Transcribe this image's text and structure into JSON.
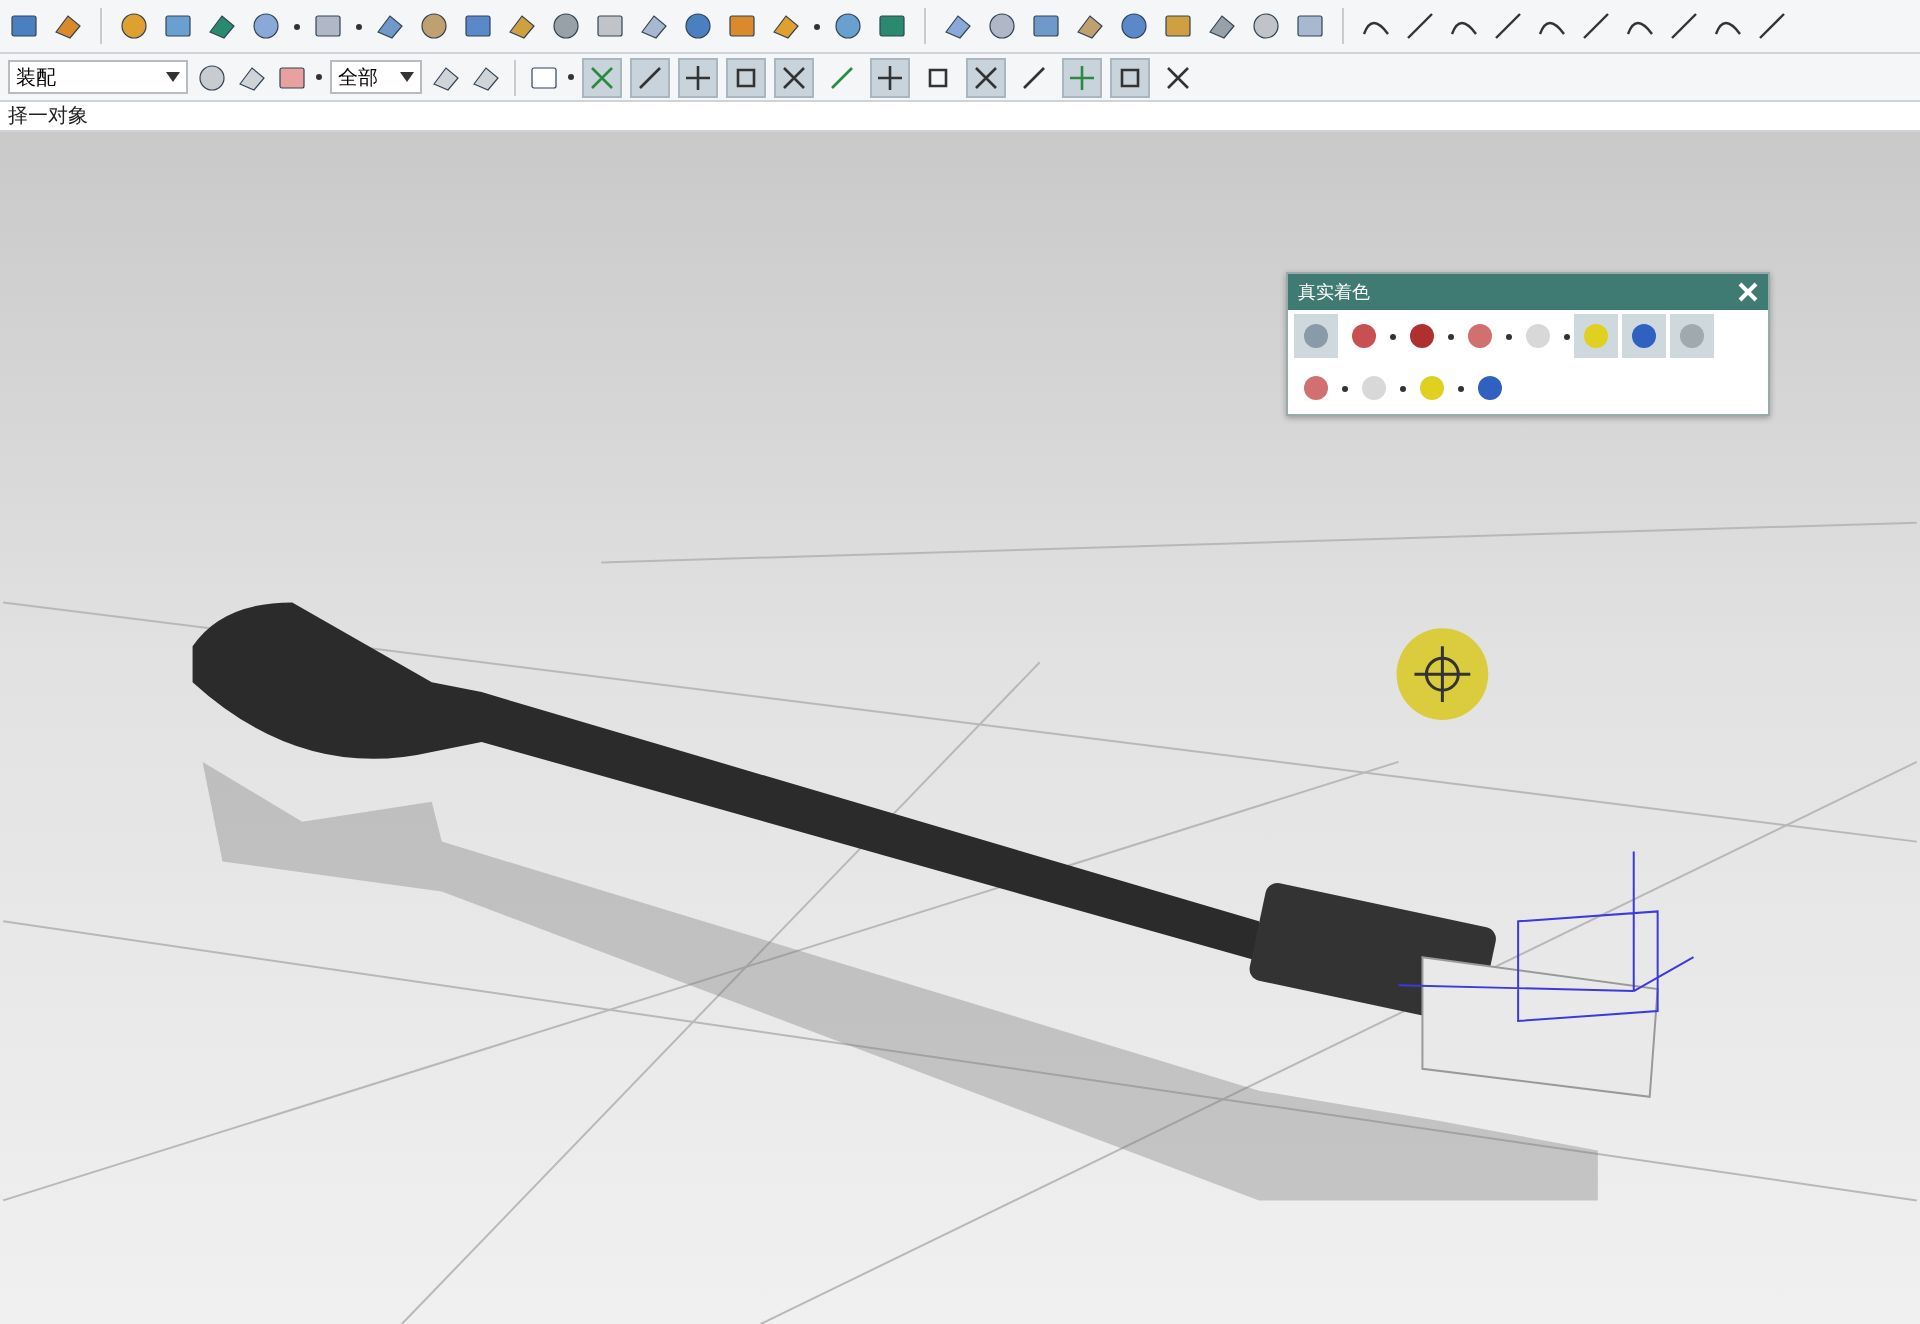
{
  "selection_bar": {
    "filter_dropdown": {
      "value": "装配"
    },
    "scope_dropdown": {
      "value": "全部"
    },
    "snap_buttons": [
      {
        "selected": true
      },
      {
        "selected": true
      },
      {
        "selected": true
      },
      {
        "selected": true
      },
      {
        "selected": true
      },
      {
        "selected": false
      },
      {
        "selected": true
      },
      {
        "selected": false
      },
      {
        "selected": true
      },
      {
        "selected": false
      },
      {
        "selected": true
      },
      {
        "selected": true
      },
      {
        "selected": false
      }
    ]
  },
  "prompt": "择一对象",
  "shading_panel": {
    "title": "真实着色",
    "tool_rows": [
      [
        {
          "selected": true
        },
        {
          "selected": false
        },
        {
          "selected": false
        },
        {
          "selected": false
        },
        {
          "selected": false
        },
        {
          "selected": true
        },
        {
          "selected": true
        },
        {
          "selected": true
        }
      ],
      [
        {
          "selected": false
        },
        {
          "selected": false
        },
        {
          "selected": false
        },
        {
          "selected": false
        }
      ]
    ]
  }
}
